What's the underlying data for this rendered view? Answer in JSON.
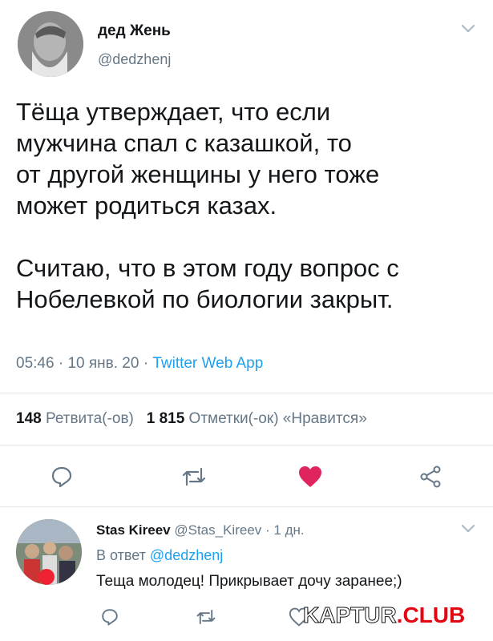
{
  "tweet": {
    "author_name": "дед Жень",
    "author_handle": "@dedzhenj",
    "text": "Тёща утверждает, что если\nмужчина спал с казашкой, то\nот другой женщины у него тоже\nможет родиться казах.\n\nСчитаю, что в этом году вопрос с\nНобелевкой по биологии закрыт.",
    "time": "05:46",
    "date": "10 янв. 20",
    "separator": " · ",
    "source": "Twitter Web App",
    "retweets_count": "148",
    "retweets_label": "Ретвита(-ов)",
    "likes_count": "1 815",
    "likes_label": "Отметки(-ок) «Нравится»"
  },
  "reply": {
    "author_name": "Stas Kireev",
    "author_handle": "@Stas_Kireev",
    "time": "1 дн.",
    "replying_to_prefix": "В ответ",
    "replying_to_handle": "@dedzhenj",
    "text": "Теща молодец! Прикрывает дочу заранее;)"
  },
  "watermark": {
    "part1": "KAPTUR",
    "part2": ".CLUB"
  },
  "icons": [
    "reply-icon",
    "retweet-icon",
    "like-icon",
    "share-icon",
    "chevron-down-icon"
  ],
  "colors": {
    "like": "#e0245e",
    "link": "#1da1f2",
    "muted": "#657786",
    "watermark_red": "#e30613"
  }
}
